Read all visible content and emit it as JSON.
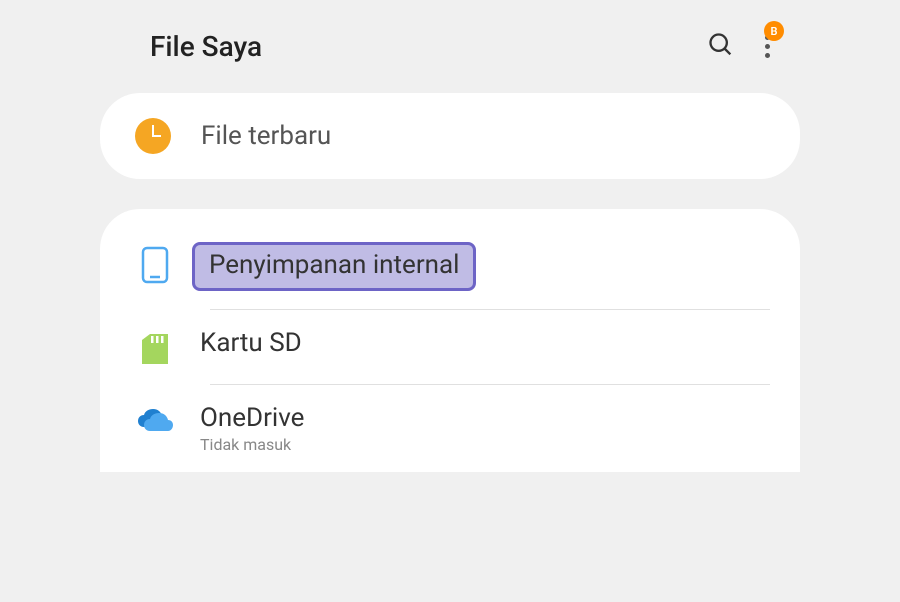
{
  "header": {
    "title": "File Saya",
    "badge_letter": "B"
  },
  "recent": {
    "label": "File terbaru"
  },
  "storage": {
    "internal": {
      "label": "Penyimpanan internal"
    },
    "sdcard": {
      "label": "Kartu SD"
    },
    "onedrive": {
      "label": "OneDrive",
      "sublabel": "Tidak masuk"
    }
  }
}
